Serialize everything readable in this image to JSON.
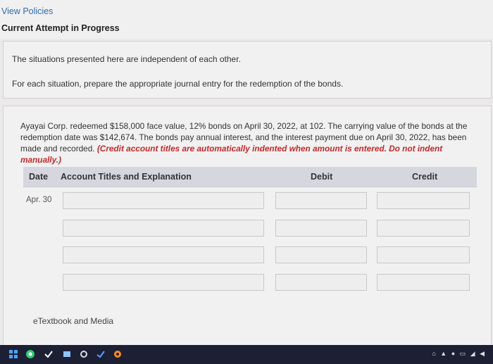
{
  "header": {
    "view_policies": "View Policies",
    "attempt_status": "Current Attempt in Progress"
  },
  "intro": {
    "line1": "The situations presented here are independent of each other.",
    "line2": "For each situation, prepare the appropriate journal entry for the redemption of the bonds."
  },
  "problem": {
    "text": "Ayayai Corp. redeemed $158,000 face value, 12% bonds on April 30, 2022, at 102. The carrying value of the bonds at the redemption date was $142,674. The bonds pay annual interest, and the interest payment due on April 30, 2022, has been made and recorded.",
    "instruction": "(Credit account titles are automatically indented when amount is entered. Do not indent manually.)"
  },
  "table": {
    "headers": {
      "date": "Date",
      "account": "Account Titles and Explanation",
      "debit": "Debit",
      "credit": "Credit"
    },
    "rows": [
      {
        "date": "Apr. 30",
        "account": "",
        "debit": "",
        "credit": ""
      },
      {
        "date": "",
        "account": "",
        "debit": "",
        "credit": ""
      },
      {
        "date": "",
        "account": "",
        "debit": "",
        "credit": ""
      },
      {
        "date": "",
        "account": "",
        "debit": "",
        "credit": ""
      }
    ]
  },
  "links": {
    "etextbook": "eTextbook and Media"
  },
  "colors": {
    "link": "#2b6cb0",
    "instruction": "#c62828",
    "table_header": "#d6d7de",
    "taskbar": "#1d1f35"
  },
  "taskbar_icons": [
    "windows-icon",
    "chrome-icon",
    "mail-icon",
    "image-icon",
    "settings-icon",
    "check-icon",
    "app-icon"
  ]
}
